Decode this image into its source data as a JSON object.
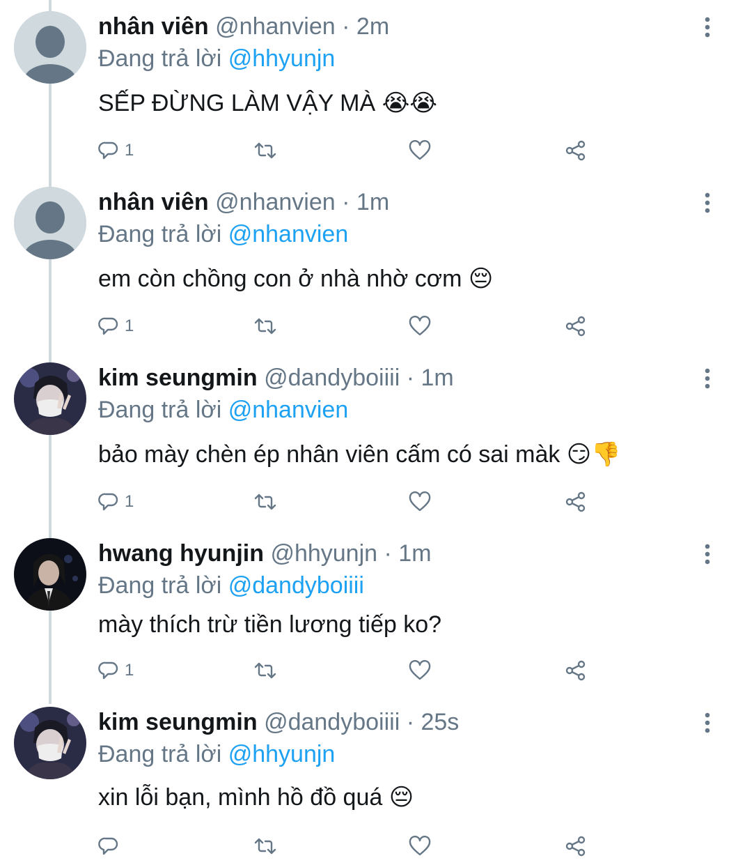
{
  "colors": {
    "accent": "#1da1f2",
    "muted": "#657786",
    "text": "#14171a",
    "thread_line": "#cfd9de"
  },
  "icons": {
    "reply": "reply-icon",
    "retweet": "retweet-icon",
    "like": "heart-icon",
    "share": "share-icon",
    "more": "more-vertical-icon"
  },
  "replying_prefix": "Đang trả lời",
  "tweets": [
    {
      "name": "nhân viên",
      "handle": "@nhanvien",
      "dot": "·",
      "time": "2m",
      "reply_to": "@hhyunjn",
      "text": "SẾP ĐỪNG LÀM VẬY MÀ 😭😭",
      "reply_count": "1",
      "avatar": "default-avatar"
    },
    {
      "name": "nhân viên",
      "handle": "@nhanvien",
      "dot": "·",
      "time": "1m",
      "reply_to": "@nhanvien",
      "text": "em còn chồng con ở nhà nhờ cơm 😔",
      "reply_count": "1",
      "avatar": "default-avatar"
    },
    {
      "name": "kim seungmin",
      "handle": "@dandyboiiii",
      "dot": "·",
      "time": "1m",
      "reply_to": "@nhanvien",
      "text": "bảo mày chèn ép nhân viên cấm có sai màk 😏👎",
      "reply_count": "1",
      "avatar": "photo-avatar-seungmin"
    },
    {
      "name": "hwang hyunjin",
      "handle": "@hhyunjn",
      "dot": "·",
      "time": "1m",
      "reply_to": "@dandyboiiii",
      "text": "mày thích trừ tiền lương tiếp ko?",
      "reply_count": "1",
      "avatar": "photo-avatar-hyunjin"
    },
    {
      "name": "kim seungmin",
      "handle": "@dandyboiiii",
      "dot": "·",
      "time": "25s",
      "reply_to": "@hhyunjn",
      "text": "xin lỗi bạn, mình hồ đồ quá 😔",
      "reply_count": "",
      "avatar": "photo-avatar-seungmin"
    }
  ]
}
